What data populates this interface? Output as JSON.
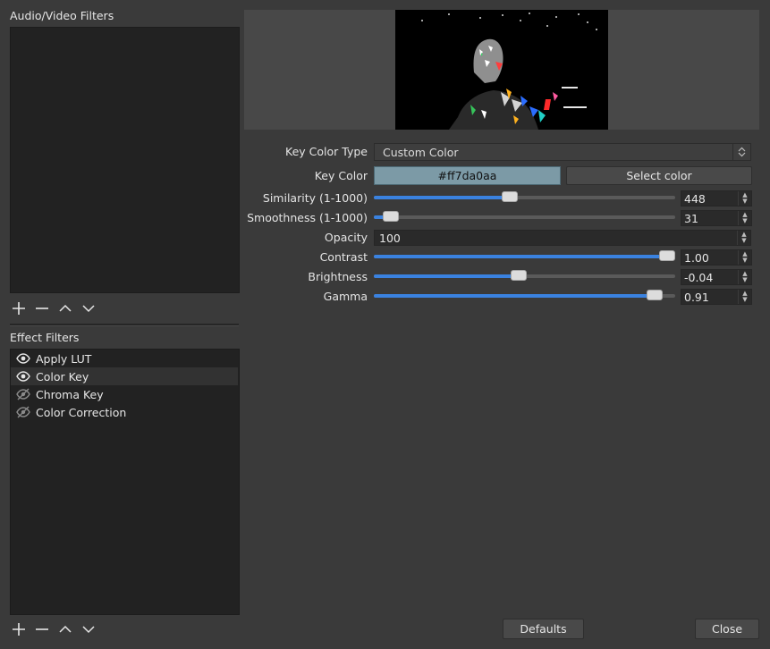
{
  "left_panel": {
    "av_filters_label": "Audio/Video Filters",
    "effect_filters_label": "Effect Filters",
    "effect_filters": [
      {
        "label": "Apply LUT",
        "visible": true
      },
      {
        "label": "Color Key",
        "visible": true,
        "selected": true
      },
      {
        "label": "Chroma Key",
        "visible": false
      },
      {
        "label": "Color Correction",
        "visible": false
      }
    ]
  },
  "properties": {
    "key_color_type": {
      "label": "Key Color Type",
      "value": "Custom Color"
    },
    "key_color": {
      "label": "Key Color",
      "value": "#ff7da0aa",
      "swatch_color": "#7c9aa6",
      "select_button": "Select color"
    },
    "similarity": {
      "label": "Similarity (1-1000)",
      "value": "448",
      "fraction": 0.448
    },
    "smoothness": {
      "label": "Smoothness (1-1000)",
      "value": "31",
      "fraction": 0.031
    },
    "opacity": {
      "label": "Opacity",
      "value": "100"
    },
    "contrast": {
      "label": "Contrast",
      "value": "1.00",
      "fraction": 1.0
    },
    "brightness": {
      "label": "Brightness",
      "value": "-0.04",
      "fraction": 0.48
    },
    "gamma": {
      "label": "Gamma",
      "value": "0.91",
      "fraction": 0.955
    }
  },
  "footer": {
    "defaults_button": "Defaults",
    "close_button": "Close"
  },
  "colors": {
    "accent": "#3a82e0",
    "panel_bg": "#222222",
    "window_bg": "#3a3a3a"
  }
}
